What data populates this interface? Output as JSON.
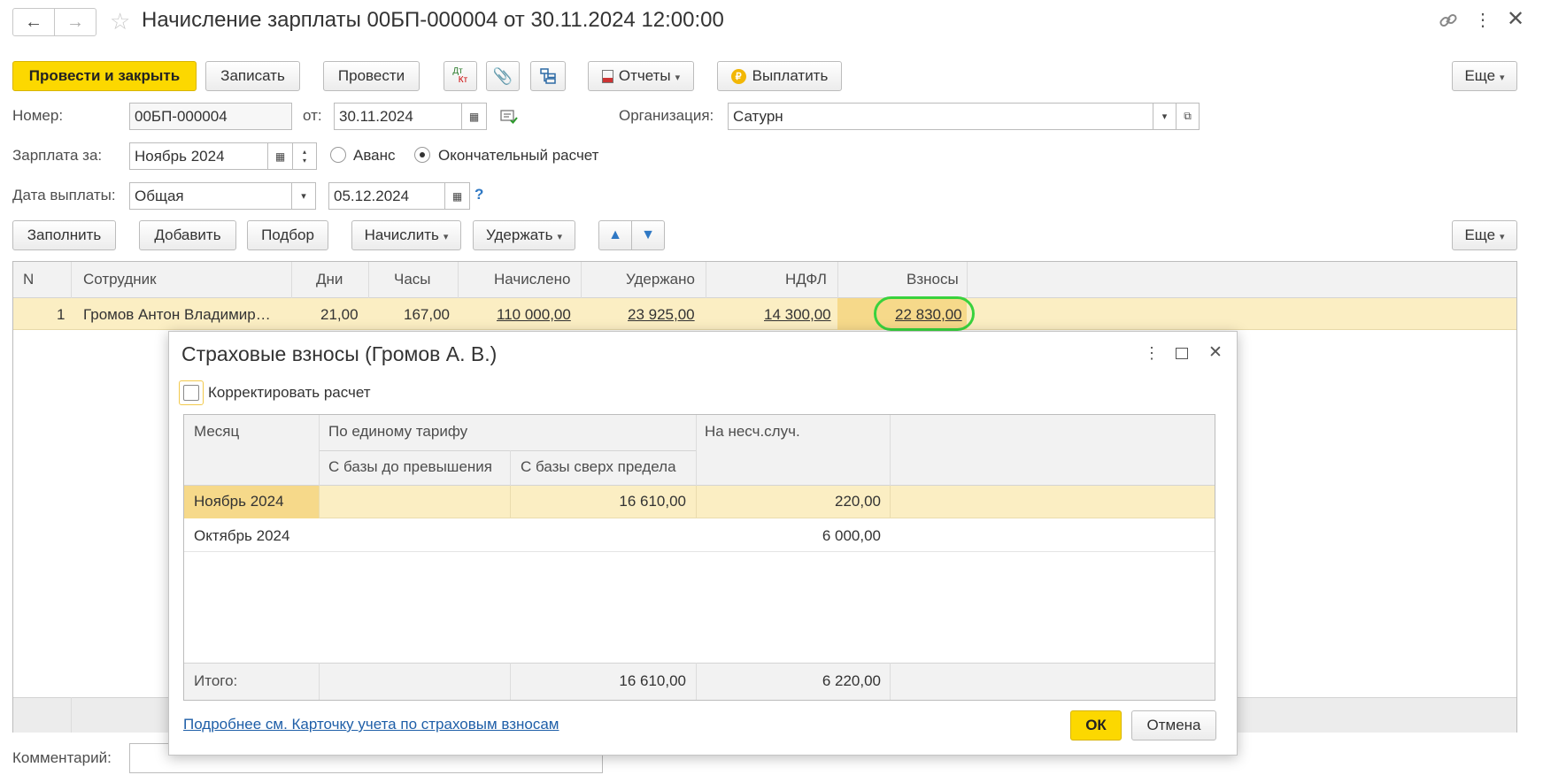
{
  "window": {
    "title": "Начисление зарплаты 00БП-000004 от 30.11.2024 12:00:00",
    "back_icon": "arrow-left-icon",
    "forward_icon": "arrow-right-icon",
    "favorite_icon": "star-icon",
    "link_icon": "link-icon",
    "menu_icon": "more-vertical-icon",
    "close_icon": "close-icon"
  },
  "toolbar": {
    "post_close": "Провести и закрыть",
    "save": "Записать",
    "post": "Провести",
    "dt_kt_top": "Дт",
    "dt_kt_bottom": "Кт",
    "reports": "Отчеты",
    "pay": "Выплатить",
    "more": "Еще"
  },
  "form": {
    "number_label": "Номер:",
    "number_value": "00БП-000004",
    "from_label": "от:",
    "date_value": "30.11.2024",
    "org_label": "Организация:",
    "org_value": "Сатурн",
    "salary_for_label": "Зарплата за:",
    "salary_for_value": "Ноябрь 2024",
    "advance_label": "Аванс",
    "final_label": "Окончательный расчет",
    "pay_date_label": "Дата выплаты:",
    "pay_date_type": "Общая",
    "pay_date_value": "05.12.2024",
    "help": "?"
  },
  "table_toolbar": {
    "fill": "Заполнить",
    "add": "Добавить",
    "pick": "Подбор",
    "accrue": "Начислить",
    "withhold": "Удержать",
    "more": "Еще"
  },
  "table": {
    "headers": [
      "N",
      "Сотрудник",
      "Дни",
      "Часы",
      "Начислено",
      "Удержано",
      "НДФЛ",
      "Взносы"
    ],
    "rows": [
      [
        "1",
        "Громов Антон Владимир…",
        "21,00",
        "167,00",
        "110 000,00",
        "23 925,00",
        "14 300,00",
        "22 830,00"
      ]
    ]
  },
  "comment_label": "Комментарий:",
  "dialog": {
    "title": "Страховые взносы (Громов А. В.)",
    "adjust_label": "Корректировать расчет",
    "headers": {
      "month": "Месяц",
      "single_tariff": "По единому тарифу",
      "base_below": "С базы до превышения",
      "base_above": "С базы сверх предела",
      "accident": "На несч.случ."
    },
    "rows": [
      {
        "month": "Ноябрь 2024",
        "below": "",
        "above": "16 610,00",
        "accident": "220,00"
      },
      {
        "month": "Октябрь 2024",
        "below": "",
        "above": "",
        "accident": "6 000,00"
      }
    ],
    "total": {
      "label": "Итого:",
      "below": "",
      "above": "16 610,00",
      "accident": "6 220,00"
    },
    "details_link": "Подробнее см. Карточку учета по страховым взносам",
    "ok": "ОК",
    "cancel": "Отмена"
  }
}
